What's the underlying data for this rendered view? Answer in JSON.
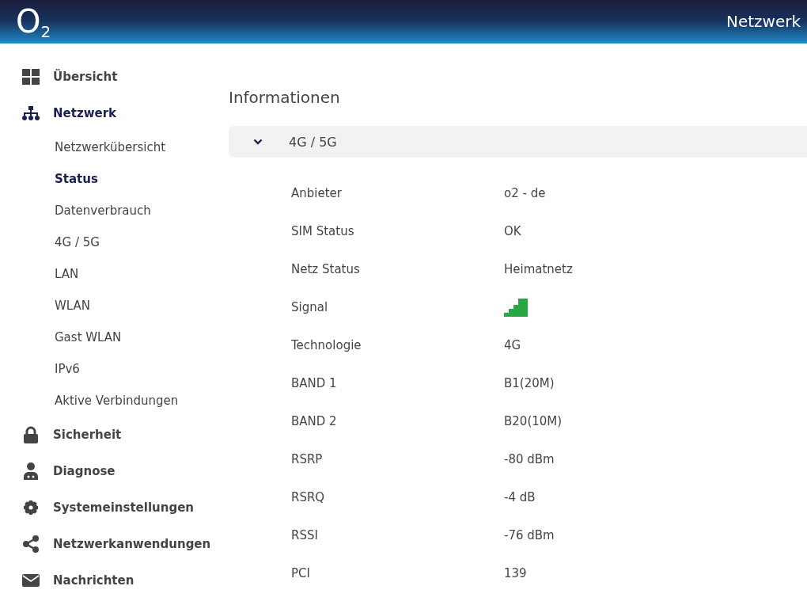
{
  "header": {
    "logo": "O$_{2}$",
    "title": "Netzwerk"
  },
  "sidebar": {
    "items": [
      {
        "label": "Übersicht",
        "selected": false
      },
      {
        "label": "Netzwerk",
        "selected": true,
        "children": [
          {
            "label": "Netzwerkübersicht",
            "selected": false
          },
          {
            "label": "Status",
            "selected": true
          },
          {
            "label": "Datenverbrauch",
            "selected": false
          },
          {
            "label": "4G / 5G",
            "selected": false
          },
          {
            "label": "LAN",
            "selected": false
          },
          {
            "label": "WLAN",
            "selected": false
          },
          {
            "label": "Gast WLAN",
            "selected": false
          },
          {
            "label": "IPv6",
            "selected": false
          },
          {
            "label": "Aktive Verbindungen",
            "selected": false
          }
        ]
      },
      {
        "label": "Sicherheit",
        "selected": false
      },
      {
        "label": "Diagnose",
        "selected": false
      },
      {
        "label": "Systemeinstellungen",
        "selected": false
      },
      {
        "label": "Netzwerkanwendungen",
        "selected": false
      },
      {
        "label": "Nachrichten",
        "selected": false
      }
    ]
  },
  "content": {
    "title": "Informationen",
    "section": {
      "title": "4G / 5G",
      "expanded": true,
      "rows": [
        {
          "kind": "text",
          "label": "Anbieter",
          "value": "o2 - de"
        },
        {
          "kind": "text",
          "label": "SIM Status",
          "value": "OK"
        },
        {
          "kind": "text",
          "label": "Netz Status",
          "value": "Heimatnetz"
        },
        {
          "kind": "signal",
          "label": "Signal"
        },
        {
          "kind": "text",
          "label": "Technologie",
          "value": "4G"
        },
        {
          "kind": "text",
          "label": "BAND 1",
          "value": "B1(20M)"
        },
        {
          "kind": "text",
          "label": "BAND 2",
          "value": "B20(10M)"
        },
        {
          "kind": "text",
          "label": "RSRP",
          "value": "-80 dBm"
        },
        {
          "kind": "text",
          "label": "RSRQ",
          "value": "-4 dB"
        },
        {
          "kind": "text",
          "label": "RSSI",
          "value": "-76 dBm"
        },
        {
          "kind": "text",
          "label": "PCI",
          "value": "139"
        }
      ]
    }
  }
}
